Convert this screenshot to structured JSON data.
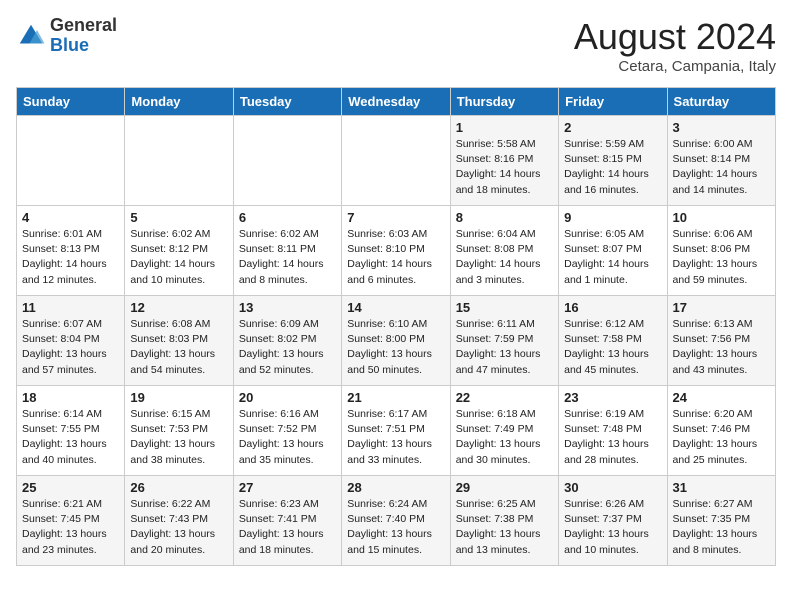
{
  "logo": {
    "general": "General",
    "blue": "Blue"
  },
  "title": "August 2024",
  "subtitle": "Cetara, Campania, Italy",
  "days_of_week": [
    "Sunday",
    "Monday",
    "Tuesday",
    "Wednesday",
    "Thursday",
    "Friday",
    "Saturday"
  ],
  "weeks": [
    [
      {
        "day": "",
        "text": ""
      },
      {
        "day": "",
        "text": ""
      },
      {
        "day": "",
        "text": ""
      },
      {
        "day": "",
        "text": ""
      },
      {
        "day": "1",
        "text": "Sunrise: 5:58 AM\nSunset: 8:16 PM\nDaylight: 14 hours\nand 18 minutes."
      },
      {
        "day": "2",
        "text": "Sunrise: 5:59 AM\nSunset: 8:15 PM\nDaylight: 14 hours\nand 16 minutes."
      },
      {
        "day": "3",
        "text": "Sunrise: 6:00 AM\nSunset: 8:14 PM\nDaylight: 14 hours\nand 14 minutes."
      }
    ],
    [
      {
        "day": "4",
        "text": "Sunrise: 6:01 AM\nSunset: 8:13 PM\nDaylight: 14 hours\nand 12 minutes."
      },
      {
        "day": "5",
        "text": "Sunrise: 6:02 AM\nSunset: 8:12 PM\nDaylight: 14 hours\nand 10 minutes."
      },
      {
        "day": "6",
        "text": "Sunrise: 6:02 AM\nSunset: 8:11 PM\nDaylight: 14 hours\nand 8 minutes."
      },
      {
        "day": "7",
        "text": "Sunrise: 6:03 AM\nSunset: 8:10 PM\nDaylight: 14 hours\nand 6 minutes."
      },
      {
        "day": "8",
        "text": "Sunrise: 6:04 AM\nSunset: 8:08 PM\nDaylight: 14 hours\nand 3 minutes."
      },
      {
        "day": "9",
        "text": "Sunrise: 6:05 AM\nSunset: 8:07 PM\nDaylight: 14 hours\nand 1 minute."
      },
      {
        "day": "10",
        "text": "Sunrise: 6:06 AM\nSunset: 8:06 PM\nDaylight: 13 hours\nand 59 minutes."
      }
    ],
    [
      {
        "day": "11",
        "text": "Sunrise: 6:07 AM\nSunset: 8:04 PM\nDaylight: 13 hours\nand 57 minutes."
      },
      {
        "day": "12",
        "text": "Sunrise: 6:08 AM\nSunset: 8:03 PM\nDaylight: 13 hours\nand 54 minutes."
      },
      {
        "day": "13",
        "text": "Sunrise: 6:09 AM\nSunset: 8:02 PM\nDaylight: 13 hours\nand 52 minutes."
      },
      {
        "day": "14",
        "text": "Sunrise: 6:10 AM\nSunset: 8:00 PM\nDaylight: 13 hours\nand 50 minutes."
      },
      {
        "day": "15",
        "text": "Sunrise: 6:11 AM\nSunset: 7:59 PM\nDaylight: 13 hours\nand 47 minutes."
      },
      {
        "day": "16",
        "text": "Sunrise: 6:12 AM\nSunset: 7:58 PM\nDaylight: 13 hours\nand 45 minutes."
      },
      {
        "day": "17",
        "text": "Sunrise: 6:13 AM\nSunset: 7:56 PM\nDaylight: 13 hours\nand 43 minutes."
      }
    ],
    [
      {
        "day": "18",
        "text": "Sunrise: 6:14 AM\nSunset: 7:55 PM\nDaylight: 13 hours\nand 40 minutes."
      },
      {
        "day": "19",
        "text": "Sunrise: 6:15 AM\nSunset: 7:53 PM\nDaylight: 13 hours\nand 38 minutes."
      },
      {
        "day": "20",
        "text": "Sunrise: 6:16 AM\nSunset: 7:52 PM\nDaylight: 13 hours\nand 35 minutes."
      },
      {
        "day": "21",
        "text": "Sunrise: 6:17 AM\nSunset: 7:51 PM\nDaylight: 13 hours\nand 33 minutes."
      },
      {
        "day": "22",
        "text": "Sunrise: 6:18 AM\nSunset: 7:49 PM\nDaylight: 13 hours\nand 30 minutes."
      },
      {
        "day": "23",
        "text": "Sunrise: 6:19 AM\nSunset: 7:48 PM\nDaylight: 13 hours\nand 28 minutes."
      },
      {
        "day": "24",
        "text": "Sunrise: 6:20 AM\nSunset: 7:46 PM\nDaylight: 13 hours\nand 25 minutes."
      }
    ],
    [
      {
        "day": "25",
        "text": "Sunrise: 6:21 AM\nSunset: 7:45 PM\nDaylight: 13 hours\nand 23 minutes."
      },
      {
        "day": "26",
        "text": "Sunrise: 6:22 AM\nSunset: 7:43 PM\nDaylight: 13 hours\nand 20 minutes."
      },
      {
        "day": "27",
        "text": "Sunrise: 6:23 AM\nSunset: 7:41 PM\nDaylight: 13 hours\nand 18 minutes."
      },
      {
        "day": "28",
        "text": "Sunrise: 6:24 AM\nSunset: 7:40 PM\nDaylight: 13 hours\nand 15 minutes."
      },
      {
        "day": "29",
        "text": "Sunrise: 6:25 AM\nSunset: 7:38 PM\nDaylight: 13 hours\nand 13 minutes."
      },
      {
        "day": "30",
        "text": "Sunrise: 6:26 AM\nSunset: 7:37 PM\nDaylight: 13 hours\nand 10 minutes."
      },
      {
        "day": "31",
        "text": "Sunrise: 6:27 AM\nSunset: 7:35 PM\nDaylight: 13 hours\nand 8 minutes."
      }
    ]
  ]
}
